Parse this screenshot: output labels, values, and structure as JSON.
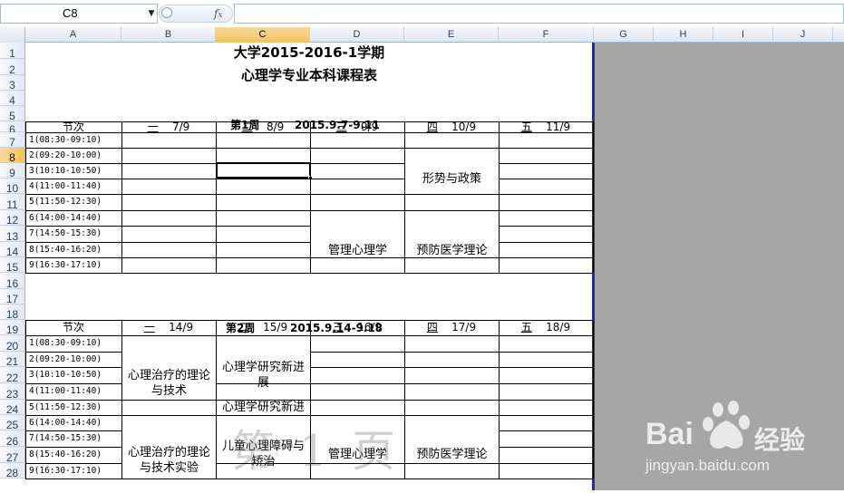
{
  "name_box": "C8",
  "columns": [
    "A",
    "B",
    "C",
    "D",
    "E",
    "F",
    "G",
    "H",
    "I",
    "J"
  ],
  "rows": [
    "1",
    "2",
    "3",
    "4",
    "5",
    "6",
    "7",
    "8",
    "9",
    "10",
    "11",
    "12",
    "13",
    "14",
    "15",
    "16",
    "17",
    "18",
    "19",
    "20",
    "21",
    "22",
    "23",
    "24",
    "25",
    "26",
    "27",
    "28"
  ],
  "title1": "大学2015-2016-1学期",
  "title2": "心理学专业本科课程表",
  "week1": {
    "label": "第1周",
    "range": "2015.9.7-9.11"
  },
  "week2": {
    "label": "第2周",
    "range": "2015.9.14-9.18"
  },
  "header_slot": "节次",
  "week1_days": [
    {
      "day": "一",
      "date": "7/9"
    },
    {
      "day": "二",
      "date": "8/9"
    },
    {
      "day": "三",
      "date": "9/9"
    },
    {
      "day": "四",
      "date": "10/9"
    },
    {
      "day": "五",
      "date": "11/9"
    }
  ],
  "week2_days": [
    {
      "day": "一",
      "date": "14/9"
    },
    {
      "day": "二",
      "date": "15/9"
    },
    {
      "day": "三",
      "date": "16/9"
    },
    {
      "day": "四",
      "date": "17/9"
    },
    {
      "day": "五",
      "date": "18/9"
    }
  ],
  "slots": [
    "1(08:30-09:10)",
    "2(09:20-10:00)",
    "3(10:10-10:50)",
    "4(11:00-11:40)",
    "5(11:50-12:30)",
    "6(14:00-14:40)",
    "7(14:50-15:30)",
    "8(15:40-16:20)",
    "9(16:30-17:10)"
  ],
  "week1_courses": {
    "thu_morning": "形势与政策",
    "wed_afternoon": "管理心理学",
    "thu_afternoon": "预防医学理论"
  },
  "week2_courses": {
    "mon_morning": "心理治疗的理论与技术",
    "tue_morning1": "心理学研究新进展",
    "tue_morning2": "心理学研究新进",
    "mon_afternoon": "心理治疗的理论与技术实验",
    "tue_afternoon": "儿童心理障碍与矫治",
    "wed_afternoon": "管理心理学",
    "thu_afternoon": "预防医学理论"
  },
  "watermark_page": "第 1 页",
  "watermark_brand": "Bai",
  "watermark_brand_cn": "经验",
  "watermark_url": "jingyan.baidu.com"
}
